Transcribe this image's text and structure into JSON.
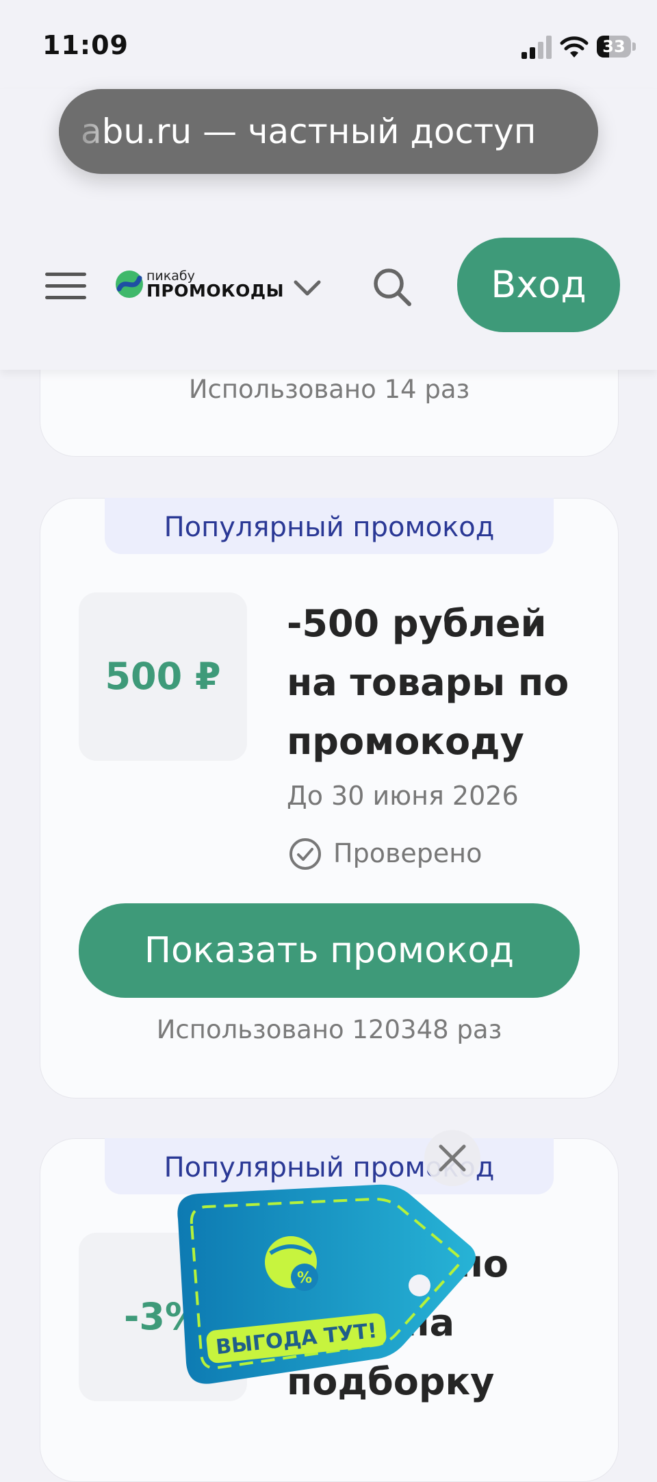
{
  "status_bar": {
    "time": "11:09",
    "battery": "33"
  },
  "browser": {
    "url_dim": "a",
    "url_text": "bu.ru — частный доступ"
  },
  "header": {
    "logo_small": "пикабу",
    "logo_big": "ПРОМОКОДЫ",
    "login_label": "Вход"
  },
  "cards": [
    {
      "used_text": "Использовано 14 раз"
    },
    {
      "badge": "Популярный промокод",
      "value": "500 ₽",
      "title": "-500 рублей на товары по промокоду",
      "deadline": "До 30 июня 2026",
      "verified": "Проверено",
      "button": "Показать промокод",
      "used_text": "Использовано 120348 раз"
    },
    {
      "badge": "Популярный промокод",
      "value": "-3%",
      "title": "Скидка по коду на подборку"
    }
  ],
  "promo_tag": {
    "label": "ВЫГОДА ТУТ!"
  },
  "colors": {
    "accent": "#3e9a79",
    "badge_text": "#2a3895",
    "badge_bg": "#eceefc"
  }
}
